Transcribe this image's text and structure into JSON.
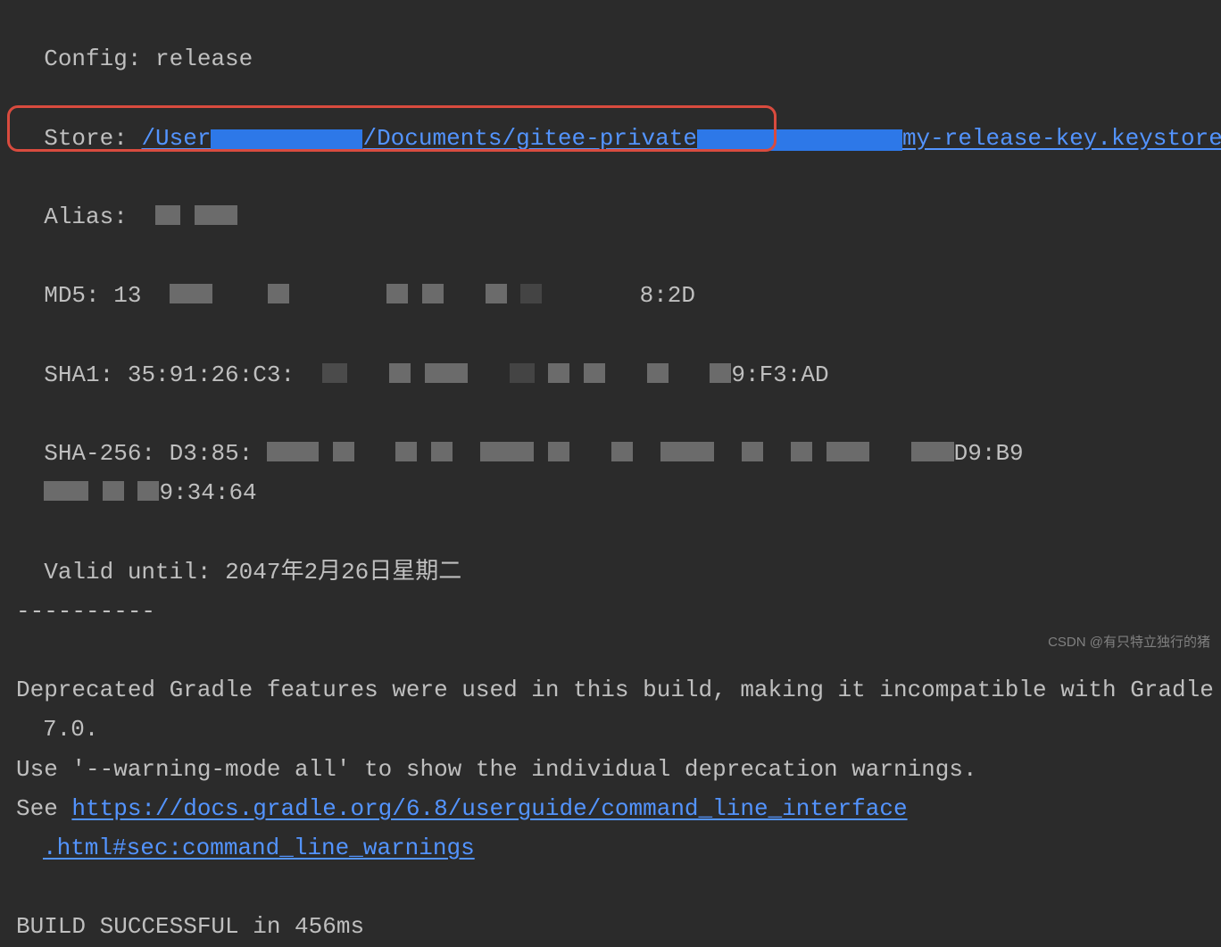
{
  "terminal": {
    "config_label": "Config:",
    "config_value": "release",
    "store_label": "Store:",
    "store_path_start": "/User",
    "store_path_mid": "/Documents/gitee-private",
    "store_path_end": "my-release-key.keystore",
    "alias_label": "Alias:",
    "md5_label": "MD5:",
    "md5_start": "13",
    "md5_end": "8:2D",
    "sha1_label": "SHA1:",
    "sha1_start": "35:91:26:C3:",
    "sha1_end": "9:F3:AD",
    "sha256_label": "SHA-256:",
    "sha256_start": "D3:85:",
    "sha256_mid": "D9:B9",
    "sha256_end": "9:34:64",
    "valid_label": "Valid until:",
    "valid_value": "2047年2月26日星期二",
    "separator": "----------",
    "deprecated_line1": "Deprecated Gradle features were used in this build, making it incompatible with Gradle",
    "deprecated_line2": "7.0.",
    "warning_line": "Use '--warning-mode all' to show the individual deprecation warnings.",
    "see_label": "See ",
    "docs_link_1": "https://docs.gradle.org/6.8/userguide/command_line_interface",
    "docs_link_2": ".html#sec:command_line_warnings",
    "build_success": "BUILD SUCCESSFUL in 456ms"
  },
  "watermark": "CSDN @有只特立独行的猪"
}
